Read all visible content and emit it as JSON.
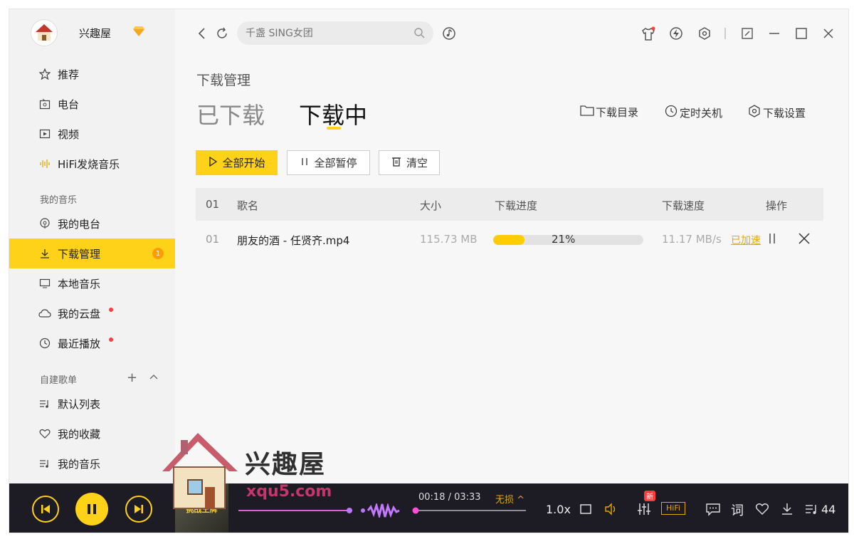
{
  "user": {
    "name": "兴趣屋",
    "vip_icon": "diamond-icon"
  },
  "sidebar": {
    "items": [
      {
        "label": "推荐",
        "icon": "star-icon"
      },
      {
        "label": "电台",
        "icon": "radio-icon"
      },
      {
        "label": "视频",
        "icon": "video-icon"
      },
      {
        "label": "HiFi发烧音乐",
        "icon": "hifi-icon"
      }
    ],
    "my_music_title": "我的音乐",
    "my_music": [
      {
        "label": "我的电台",
        "icon": "podcast-icon"
      },
      {
        "label": "下载管理",
        "icon": "download-icon",
        "badge": "1"
      },
      {
        "label": "本地音乐",
        "icon": "monitor-icon"
      },
      {
        "label": "我的云盘",
        "icon": "cloud-icon"
      },
      {
        "label": "最近播放",
        "icon": "clock-icon"
      }
    ],
    "playlists_title": "自建歌单",
    "playlists": [
      {
        "label": "默认列表",
        "icon": "playlist-icon"
      },
      {
        "label": "我的收藏",
        "icon": "heart-icon"
      },
      {
        "label": "我的音乐",
        "icon": "playlist-icon"
      }
    ]
  },
  "search": {
    "placeholder": "千盏 SING女团"
  },
  "page": {
    "title": "下载管理",
    "tabs": [
      "已下载",
      "下载中"
    ],
    "actions": [
      "下载目录",
      "定时关机",
      "下载设置"
    ],
    "buttons": {
      "start_all": "全部开始",
      "pause_all": "全部暂停",
      "clear": "清空"
    }
  },
  "table": {
    "headers": {
      "index": "01",
      "name": "歌名",
      "size": "大小",
      "progress": "下载进度",
      "speed": "下载速度",
      "ops": "操作"
    },
    "rows": [
      {
        "index": "01",
        "name": "朋友的酒 - 任贤齐.mp4",
        "size": "115.73 MB",
        "progress": 21,
        "progress_text": "21%",
        "speed": "11.17 MB/s",
        "accelerated": "已加速"
      }
    ]
  },
  "player": {
    "time": "00:18 / 03:33",
    "quality": "无损 ^",
    "speed": "1.0x",
    "hifi": "HiFi",
    "new_tag": "新",
    "lyrics": "词",
    "count": "44",
    "cover_text": "挑战王牌"
  },
  "watermark": {
    "text": "兴趣屋",
    "url": "xqu5.com"
  },
  "colors": {
    "accent": "#ffd21a",
    "player_bg": "#1d1b24",
    "badge": "#ff9d00",
    "red_dot": "#ff3b3b"
  }
}
